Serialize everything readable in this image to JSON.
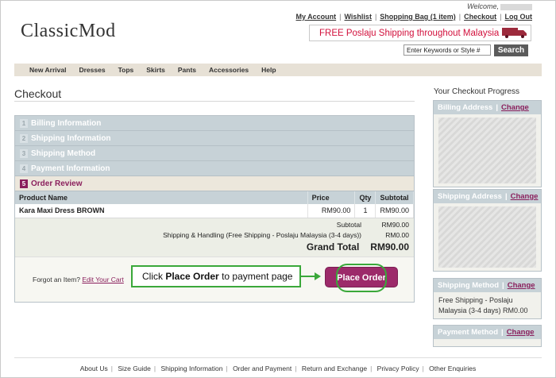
{
  "header": {
    "logo": "ClassicMod",
    "welcome": "Welcome,",
    "top_links": [
      "My Account",
      "Wishlist",
      "Shopping Bag (1 item)",
      "Checkout",
      "Log Out"
    ],
    "promo": "FREE Poslaju Shipping throughout Malaysia",
    "search_placeholder": "Enter Keywords or Style #",
    "search_button": "Search"
  },
  "nav": [
    "New Arrival",
    "Dresses",
    "Tops",
    "Skirts",
    "Pants",
    "Accessories",
    "Help"
  ],
  "checkout": {
    "title": "Checkout",
    "steps": [
      {
        "num": "1",
        "label": "Billing Information"
      },
      {
        "num": "2",
        "label": "Shipping Information"
      },
      {
        "num": "3",
        "label": "Shipping Method"
      },
      {
        "num": "4",
        "label": "Payment Information"
      },
      {
        "num": "5",
        "label": "Order Review"
      }
    ],
    "columns": [
      "Product Name",
      "Price",
      "Qty",
      "Subtotal"
    ],
    "items": [
      {
        "name": "Kara Maxi Dress BROWN",
        "price": "RM90.00",
        "qty": "1",
        "subtotal": "RM90.00"
      }
    ],
    "totals": {
      "subtotal_label": "Subtotal",
      "subtotal": "RM90.00",
      "shipping_label": "Shipping & Handling (Free Shipping - Poslaju Malaysia (3-4 days))",
      "shipping": "RM0.00",
      "grand_label": "Grand Total",
      "grand": "RM90.00"
    },
    "forgot_text": "Forgot an Item?",
    "edit_cart": "Edit Your Cart",
    "callout_prefix": "Click",
    "callout_bold": "Place Order",
    "callout_suffix": "to payment page",
    "place_order": "Place Order"
  },
  "progress": {
    "title": "Your Checkout Progress",
    "change": "Change",
    "billing": "Billing Address",
    "shipping_address": "Shipping Address",
    "shipping_method": "Shipping Method",
    "shipping_method_value": "Free Shipping - Poslaju Malaysia (3-4 days) RM0.00",
    "payment_method": "Payment Method"
  },
  "footer": [
    "About Us",
    "Size Guide",
    "Shipping Information",
    "Order and Payment",
    "Return and Exchange",
    "Privacy Policy",
    "Other Enquiries"
  ],
  "colors": {
    "brand": "#8a1f5c",
    "promo": "#d2103c",
    "highlight": "#3aa83a",
    "step_bar": "#c7d2d7"
  }
}
